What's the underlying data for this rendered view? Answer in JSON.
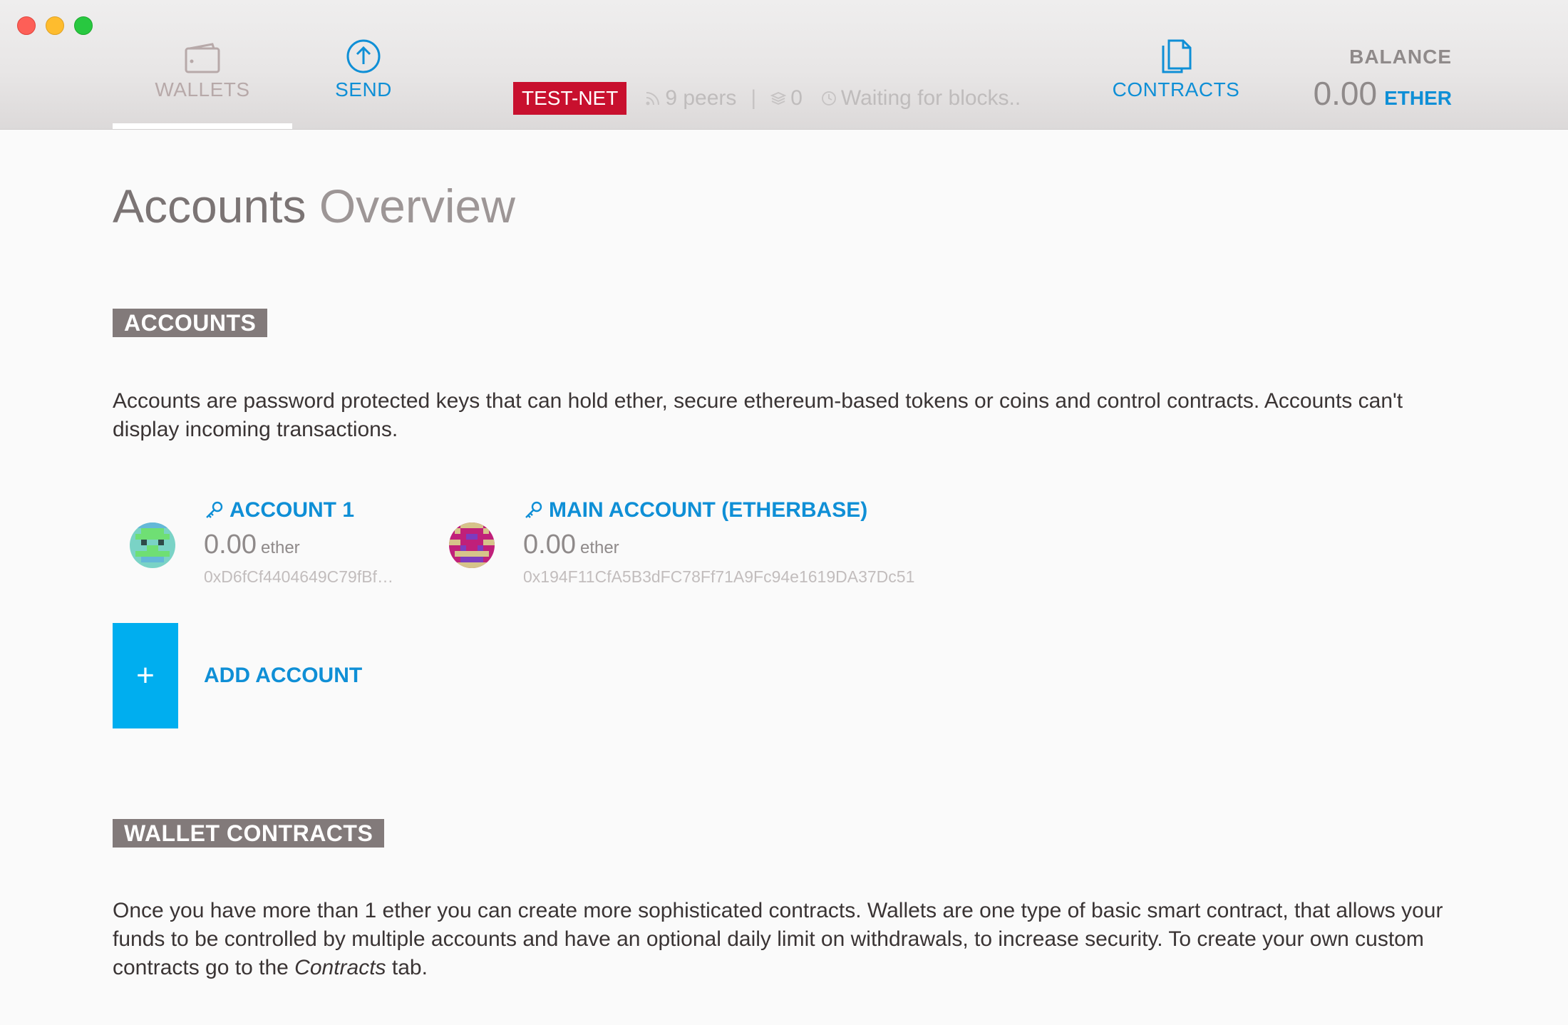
{
  "nav": {
    "wallets_label": "WALLETS",
    "send_label": "SEND",
    "contracts_label": "CONTRACTS"
  },
  "status": {
    "network": "TEST-NET",
    "peers": "9 peers",
    "blocks": "0",
    "sync": "Waiting for blocks.."
  },
  "balance": {
    "label": "BALANCE",
    "amount": "0.00",
    "unit": "ETHER"
  },
  "page": {
    "title_strong": "Accounts",
    "title_light": "Overview"
  },
  "accounts_section": {
    "label": "ACCOUNTS",
    "description": "Accounts are password protected keys that can hold ether, secure ethereum-based tokens or coins and control contracts. Accounts can't display incoming transactions."
  },
  "accounts": [
    {
      "name": "ACCOUNT 1",
      "balance": "0.00",
      "unit": "ether",
      "address": "0xD6fCf4404649C79fBf…"
    },
    {
      "name": "MAIN ACCOUNT (ETHERBASE)",
      "balance": "0.00",
      "unit": "ether",
      "address": "0x194F11CfA5B3dFC78Ff71A9Fc94e1619DA37Dc51"
    }
  ],
  "add_account": {
    "icon": "+",
    "label": "ADD ACCOUNT"
  },
  "wallet_contracts_section": {
    "label": "WALLET CONTRACTS",
    "description_before": "Once you have more than 1 ether you can create more sophisticated contracts. Wallets are one type of basic smart contract, that allows your funds to be controlled by multiple accounts and have an optional daily limit on withdrawals, to increase security. To create your own custom contracts go to the ",
    "description_emphasis": "Contracts",
    "description_after": " tab."
  },
  "colors": {
    "accent": "#0f8fd6",
    "testnet": "#c8102e",
    "add_button": "#00aeef",
    "section_label_bg": "#827a7a"
  }
}
